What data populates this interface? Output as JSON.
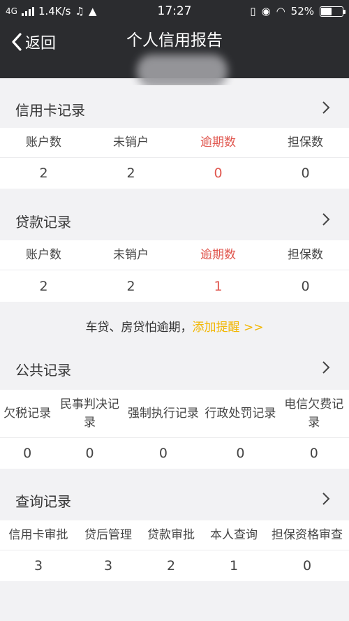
{
  "status_bar": {
    "network": "4G",
    "speed": "1.4K/s",
    "time": "17:27",
    "battery": "52%",
    "battery_level": 0.52
  },
  "nav": {
    "back_label": "返回",
    "title": "个人信用报告"
  },
  "sections": {
    "credit_card": {
      "title": "信用卡记录",
      "headers": [
        "账户数",
        "未销户",
        "逾期数",
        "担保数"
      ],
      "values": [
        "2",
        "2",
        "0",
        "0"
      ]
    },
    "loan": {
      "title": "贷款记录",
      "headers": [
        "账户数",
        "未销户",
        "逾期数",
        "担保数"
      ],
      "values": [
        "2",
        "2",
        "1",
        "0"
      ]
    },
    "public": {
      "title": "公共记录",
      "headers": [
        "欠税记录",
        "民事判决记录",
        "强制执行记录",
        "行政处罚记录",
        "电信欠费记录"
      ],
      "values": [
        "0",
        "0",
        "0",
        "0",
        "0"
      ]
    },
    "query": {
      "title": "查询记录",
      "headers": [
        "信用卡审批",
        "贷后管理",
        "贷款审批",
        "本人查询",
        "担保资格审查"
      ],
      "values": [
        "3",
        "3",
        "2",
        "1",
        "0"
      ]
    }
  },
  "reminder": {
    "text": "车贷、房贷怕逾期，",
    "link": "添加提醒 >>"
  },
  "colors": {
    "header_bg": "#2b2c2f",
    "overdue_red": "#e0574f",
    "link_yellow": "#f2b705",
    "page_bg": "#f2f2f4"
  }
}
